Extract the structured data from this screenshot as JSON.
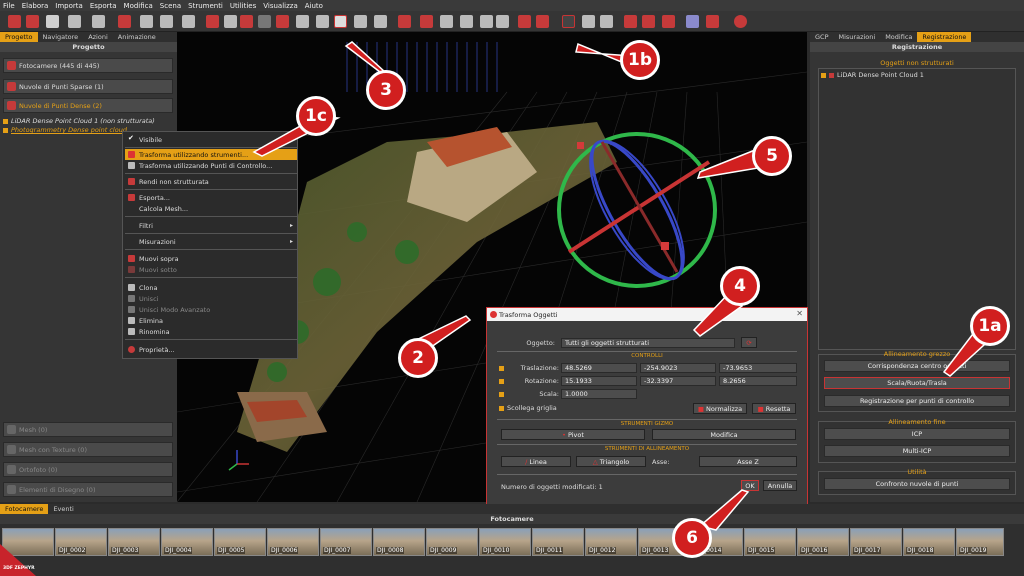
{
  "menu": [
    "File",
    "Elabora",
    "Importa",
    "Esporta",
    "Modifica",
    "Scena",
    "Strumenti",
    "Utilities",
    "Visualizza",
    "Aiuto"
  ],
  "left_panel": {
    "tabs": [
      "Progetto",
      "Navigatore",
      "Azioni",
      "Animazione"
    ],
    "title": "Progetto",
    "groups": {
      "cameras": "Fotocamere (445 di 445)",
      "sparse": "Nuvole di Punti Sparse (1)",
      "dense": "Nuvole di Punti Dense (2)",
      "mesh": "Mesh (0)",
      "textured": "Mesh con Texture (0)",
      "ortho": "Ortofoto (0)",
      "drawing": "Elementi di Disegno (0)"
    },
    "tree": [
      "LiDAR Dense Point Cloud 1 (non strutturata)",
      "Photogrammetry Dense point cloud"
    ]
  },
  "context_menu": {
    "visibile": "Visibile",
    "transform_tools": "Trasforma utilizzando strumenti...",
    "transform_control": "Trasforma utilizzando Punti di Controllo...",
    "unstructured": "Rendi non strutturata",
    "export": "Esporta...",
    "mesh": "Calcola Mesh...",
    "filters": "Filtri",
    "measures": "Misurazioni",
    "move_up": "Muovi sopra",
    "move_down": "Muovi sotto",
    "clone": "Clona",
    "merge": "Unisci",
    "merge_adv": "Unisci Modo Avanzato",
    "delete": "Elimina",
    "rename": "Rinomina",
    "properties": "Proprietà..."
  },
  "dialog": {
    "title": "Trasforma Oggetti",
    "oggetto_label": "Oggetto:",
    "oggetto_value": "Tutti gli oggetti strutturati",
    "controlli": "CONTROLLI",
    "traslazione_label": "Traslazione:",
    "traslazione": [
      "48.5269",
      "-254.9023",
      "-73.9653"
    ],
    "rotazione_label": "Rotazione:",
    "rotazione": [
      "15.1933",
      "-32.3397",
      "8.2656"
    ],
    "scala_label": "Scala:",
    "scala": "1.0000",
    "scollega": "Scollega griglia",
    "normalizza": "Normalizza",
    "resetta": "Resetta",
    "strumenti_gizmo": "STRUMENTI GIZMO",
    "pivot": "Pivot",
    "modifica": "Modifica",
    "strumenti_allineamento": "STRUMENTI DI ALLINEAMENTO",
    "linea": "Linea",
    "triangolo": "Triangolo",
    "asse_label": "Asse:",
    "asse_value": "Asse Z",
    "count": "Numero di oggetti modificati: 1",
    "ok": "OK",
    "annulla": "Annulla"
  },
  "right_panel": {
    "tabs": [
      "GCP",
      "Misurazioni",
      "Modifica",
      "Registrazione"
    ],
    "title": "Registrazione",
    "unstructured_title": "Oggetti non strutturati",
    "unstructured_item": "LiDAR Dense Point Cloud 1",
    "coarse_title": "Allineamento grezzo",
    "btn_centers": "Corrispondenza centro oggetti",
    "btn_scale": "Scala/Ruota/Trasla",
    "btn_gcp": "Registrazione per punti di controllo",
    "fine_title": "Allineamento fine",
    "btn_icp": "ICP",
    "btn_multi": "Multi-ICP",
    "util_title": "Utilità",
    "btn_compare": "Confronto nuvole di punti"
  },
  "bottom": {
    "tabs": [
      "Fotocamere",
      "Eventi"
    ],
    "title": "Fotocamere",
    "thumbs": [
      "",
      "DJI_0002",
      "DJI_0003",
      "DJI_0004",
      "DJI_0005",
      "DJI_0006",
      "DJI_0007",
      "DJI_0008",
      "DJI_0009",
      "DJI_0010",
      "DJI_0011",
      "DJI_0012",
      "DJI_0013",
      "DJI_0014",
      "DJI_0015",
      "DJI_0016",
      "DJI_0017",
      "DJI_0018",
      "DJI_0019"
    ]
  },
  "logo": "3DF ZEPHYR",
  "callouts": [
    "1a",
    "1b",
    "1c",
    "2",
    "3",
    "4",
    "5",
    "6"
  ],
  "colors": {
    "accent": "#e5a016",
    "highlight": "#c83434",
    "callout": "#d11f1f"
  }
}
